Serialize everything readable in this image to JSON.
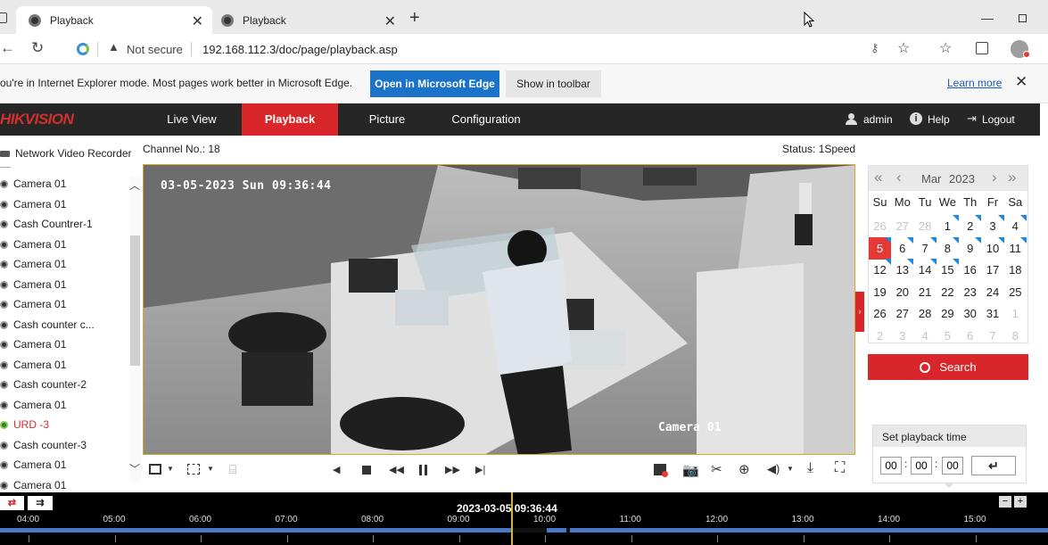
{
  "browser": {
    "tabs": [
      {
        "title": "Playback",
        "active": true
      },
      {
        "title": "Playback",
        "active": false
      }
    ],
    "address": {
      "security_label": "Not secure",
      "url": "192.168.112.3/doc/page/playback.asp"
    },
    "ie_mode": {
      "message": "ou're in Internet Explorer mode. Most pages work better in Microsoft Edge.",
      "open_edge_label": "Open in Microsoft Edge",
      "show_toolbar_label": "Show in toolbar",
      "learn_more_label": "Learn more"
    }
  },
  "app": {
    "logo": "HIKVISION",
    "nav": [
      "Live View",
      "Playback",
      "Picture",
      "Configuration"
    ],
    "active_nav": "Playback",
    "user": "admin",
    "help": "Help",
    "logout": "Logout"
  },
  "sidebar": {
    "title": "Network Video Recorder",
    "cameras": [
      "Camera 01",
      "Camera 01",
      "Cash Countrer-1",
      "Camera 01",
      "Camera 01",
      "Camera 01",
      "Camera 01",
      "Cash counter c...",
      "Camera 01",
      "Camera 01",
      "Cash counter-2",
      "Camera 01",
      "URD -3",
      "Cash counter-3",
      "Camera 01",
      "Camera 01"
    ],
    "highlighted_camera": "URD -3"
  },
  "player": {
    "channel_label": "Channel No.: 18",
    "status_label": "Status: 1Speed",
    "osd_timestamp": "03-05-2023 Sun 09:36:44",
    "osd_camera": "Camera 01"
  },
  "calendar": {
    "month": "Mar",
    "year": "2023",
    "weekdays": [
      "Su",
      "Mo",
      "Tu",
      "We",
      "Th",
      "Fr",
      "Sa"
    ],
    "weeks": [
      [
        "26",
        "27",
        "28",
        "1",
        "2",
        "3",
        "4"
      ],
      [
        "5",
        "6",
        "7",
        "8",
        "9",
        "10",
        "11"
      ],
      [
        "12",
        "13",
        "14",
        "15",
        "16",
        "17",
        "18"
      ],
      [
        "19",
        "20",
        "21",
        "22",
        "23",
        "24",
        "25"
      ],
      [
        "26",
        "27",
        "28",
        "29",
        "30",
        "31",
        "1"
      ],
      [
        "2",
        "3",
        "4",
        "5",
        "6",
        "7",
        "8"
      ]
    ],
    "selected_day": "5",
    "recorded_days": [
      "1",
      "2",
      "3",
      "4",
      "5",
      "6",
      "7",
      "8",
      "9",
      "10",
      "11",
      "12",
      "13",
      "14",
      "15"
    ],
    "search_label": "Search"
  },
  "set_playback": {
    "title": "Set playback time",
    "hh": "00",
    "mm": "00",
    "ss": "00"
  },
  "timeline": {
    "current": "2023-03-05 09:36:44",
    "hours": [
      "04:00",
      "05:00",
      "06:00",
      "07:00",
      "08:00",
      "09:00",
      "10:00",
      "11:00",
      "12:00",
      "13:00",
      "14:00",
      "15:00"
    ]
  },
  "colors": {
    "accent_red": "#d9262b",
    "record_marker": "#1e88e5",
    "timeline_bar": "#4a78c8"
  }
}
